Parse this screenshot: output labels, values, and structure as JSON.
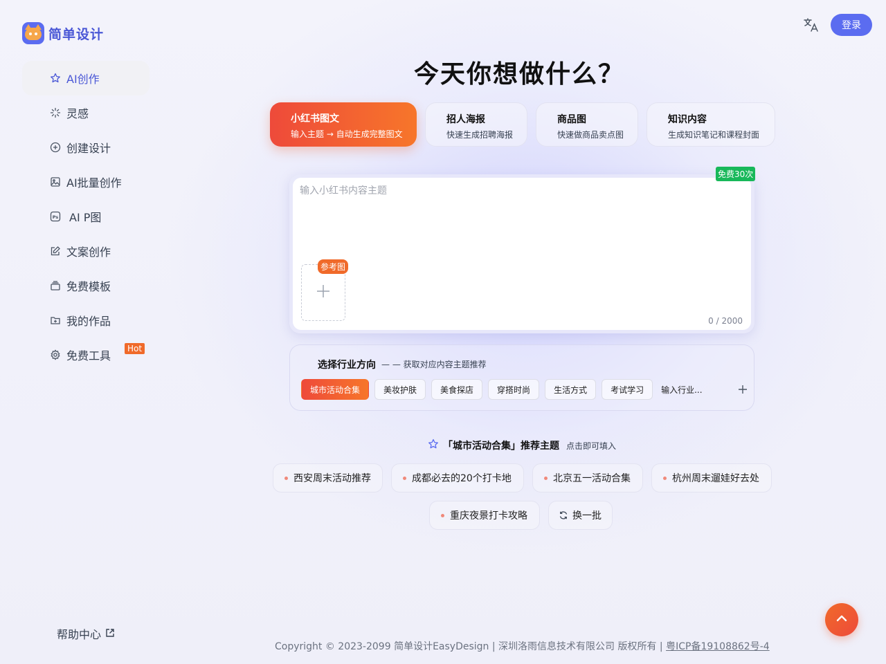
{
  "brand": {
    "name": "简单设计"
  },
  "sidebar": {
    "items": [
      {
        "label": "AI创作",
        "icon": "star-icon"
      },
      {
        "label": "灵感",
        "icon": "sparkle-icon"
      },
      {
        "label": "创建设计",
        "icon": "plus-circle-icon"
      },
      {
        "label": "AI批量创作",
        "icon": "image-icon"
      },
      {
        "label": "AI P图",
        "icon": "ps-icon"
      },
      {
        "label": "文案创作",
        "icon": "edit-icon"
      },
      {
        "label": "免费模板",
        "icon": "template-icon"
      },
      {
        "label": "我的作品",
        "icon": "folder-icon"
      },
      {
        "label": "免费工具",
        "icon": "gear-icon",
        "badge": "Hot"
      }
    ],
    "help": "帮助中心"
  },
  "header": {
    "login": "登录",
    "lang_icon": "translate-icon"
  },
  "main": {
    "title": "今天你想做什么？",
    "tabs": [
      {
        "title": "小红书图文",
        "desc": "输入主题 → 自动生成完整图文"
      },
      {
        "title": "招人海报",
        "desc": "快速生成招聘海报"
      },
      {
        "title": "商品图",
        "desc": "快速做商品卖点图"
      },
      {
        "title": "知识内容",
        "desc": "生成知识笔记和课程封面"
      }
    ],
    "editor": {
      "placeholder": "输入小红书内容主题",
      "free_badge": "免费30次",
      "ref_badge": "参考图",
      "counter": "0 / 2000"
    },
    "industry": {
      "title": "选择行业方向",
      "subtitle": "— — 获取对应内容主题推荐",
      "chips": [
        "城市活动合集",
        "美妆护肤",
        "美食探店",
        "穿搭时尚",
        "生活方式",
        "考试学习"
      ],
      "input_placeholder": "输入行业..."
    },
    "recommend": {
      "title": "「城市活动合集」推荐主题",
      "hint": "点击即可填入",
      "topics": [
        "西安周末活动推荐",
        "成都必去的20个打卡地",
        "北京五一活动合集",
        "杭州周末遛娃好去处",
        "重庆夜景打卡攻略"
      ],
      "refresh": "换一批"
    }
  },
  "footer": {
    "text": "Copyright © 2023-2099 简单设计EasyDesign | 深圳洛雨信息技术有限公司 版权所有 | ",
    "icp": "粤ICP备19108862号-4"
  },
  "colors": {
    "primary": "#5b6cf0",
    "accent_start": "#ee4a3a",
    "accent_end": "#f7762a",
    "free_green": "#18b85a"
  }
}
